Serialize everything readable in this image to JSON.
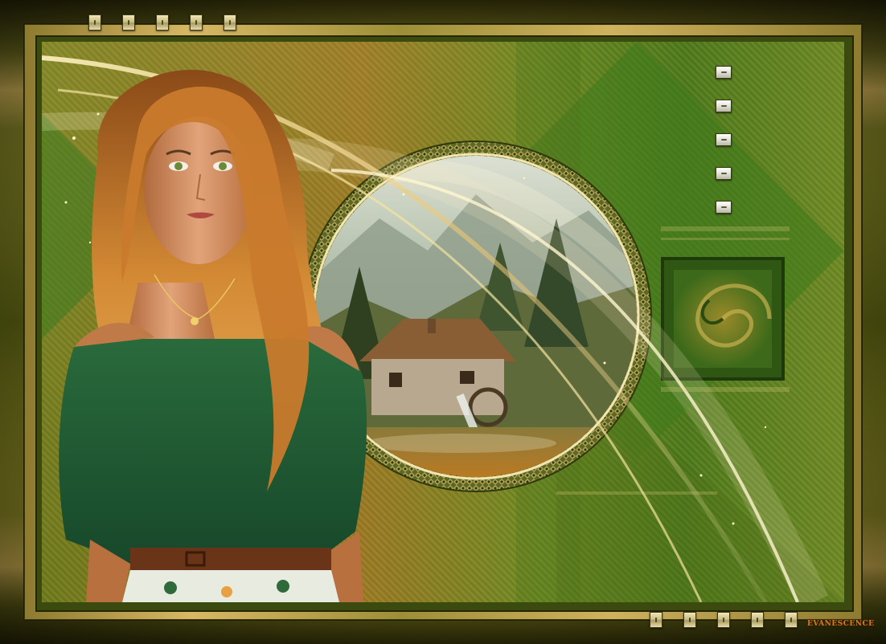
{
  "signature": "EVANESCENCE",
  "colors": {
    "frame_dark": "#2a2907",
    "frame_gold": "#d8b864",
    "panel_green": "#4d7a1c",
    "panel_amber": "#9b7a25",
    "blouse_green": "#1f5a32",
    "hair_amber": "#c8782a",
    "signature_orange": "#d97a1c"
  },
  "icons": {
    "top_buttons": [
      "square-button-icon",
      "square-button-icon",
      "square-button-icon",
      "square-button-icon",
      "square-button-icon"
    ],
    "side_buttons": [
      "square-button-icon",
      "square-button-icon",
      "square-button-icon",
      "square-button-icon",
      "square-button-icon"
    ],
    "bottom_buttons": [
      "square-button-icon",
      "square-button-icon",
      "square-button-icon",
      "square-button-icon",
      "square-button-icon"
    ],
    "scene": [
      "woman-figure",
      "round-landscape-medallion",
      "watermill-cottage",
      "swirl-square-motif",
      "gold-swoosh"
    ]
  }
}
